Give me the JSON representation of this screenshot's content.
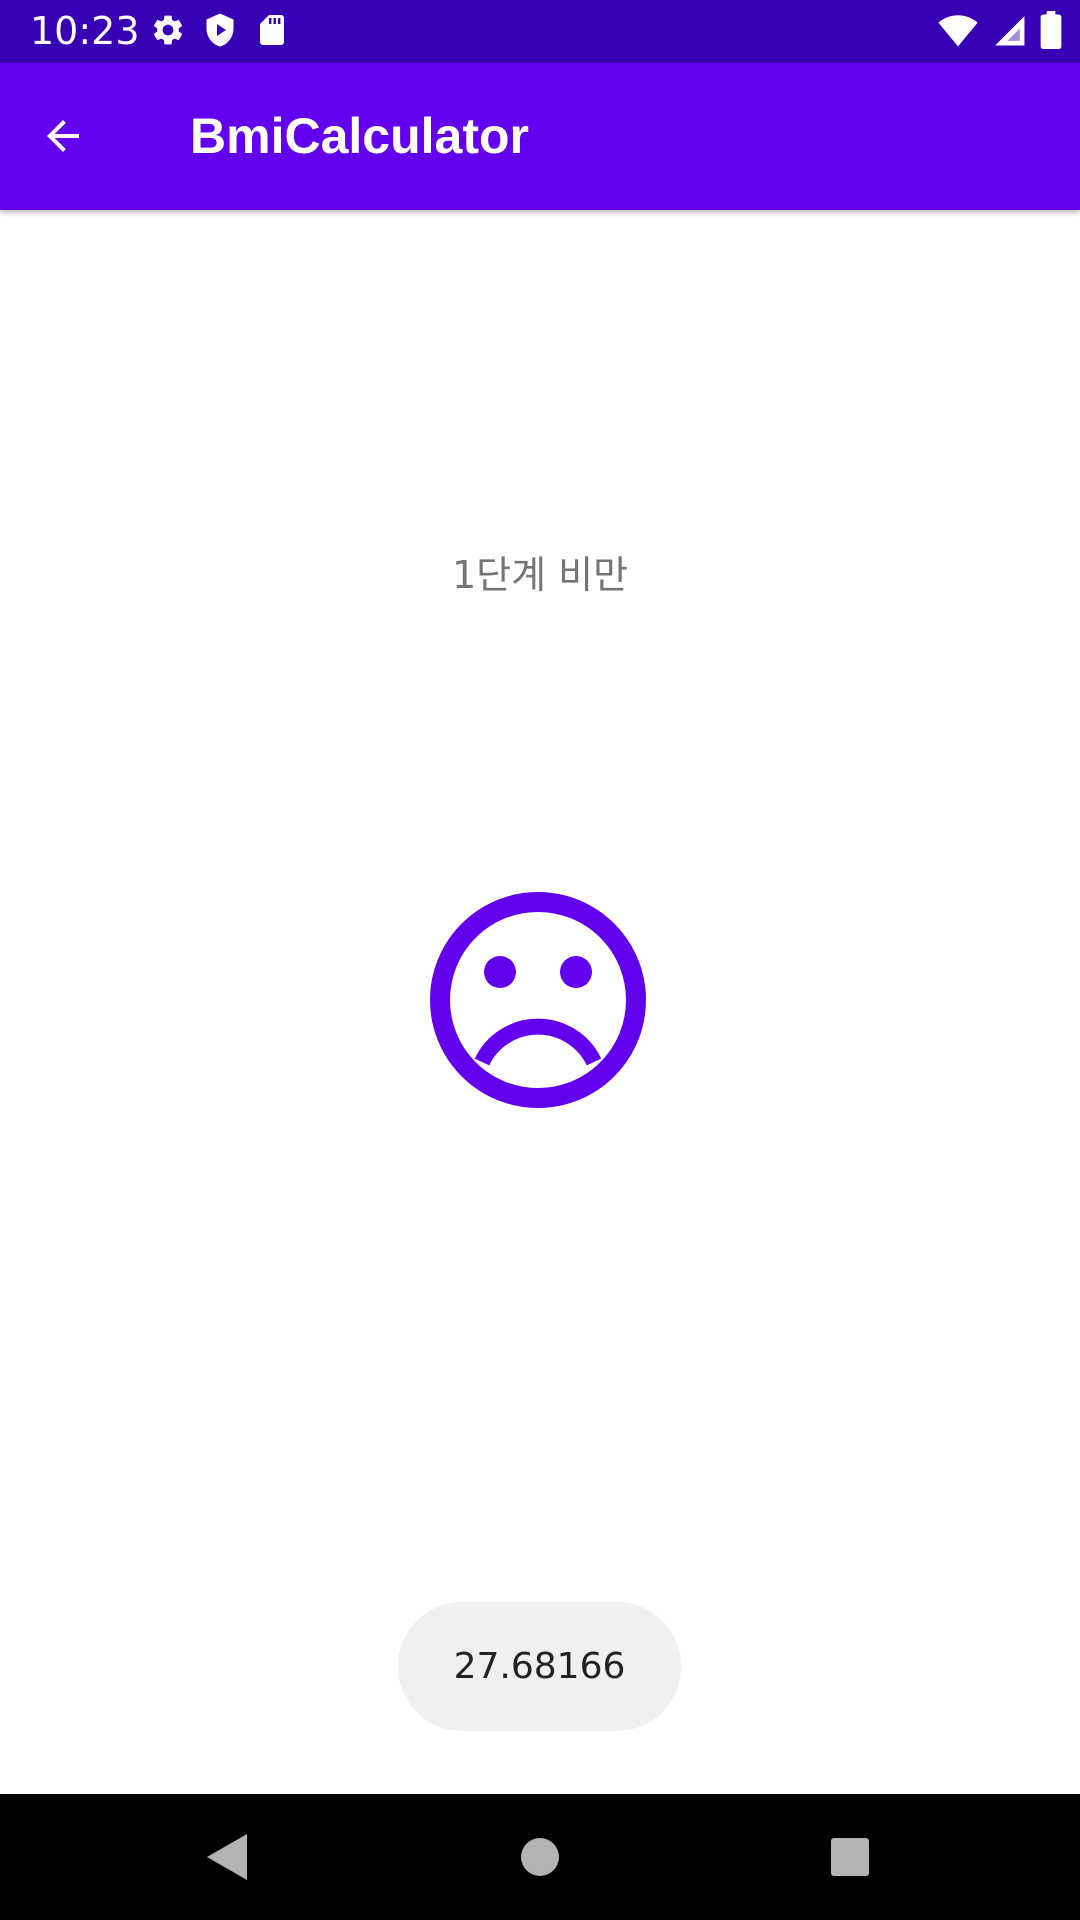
{
  "status_bar": {
    "time": "10:23",
    "left_icons": [
      "settings-icon",
      "shield-play-icon",
      "sd-card-icon"
    ],
    "right_icons": [
      "wifi-icon",
      "cell-signal-icon",
      "battery-icon"
    ]
  },
  "app_bar": {
    "title": "BmiCalculator",
    "back_icon": "arrow-back-icon"
  },
  "result": {
    "label": "1단계 비만",
    "face_icon": "sad-face-icon",
    "bmi_value": "27.68166"
  },
  "nav_bar": {
    "icons": [
      "nav-back-icon",
      "nav-home-icon",
      "nav-recents-icon"
    ]
  },
  "colors": {
    "status_bar": "#3700b3",
    "primary": "#6200ee",
    "result_text": "#757575",
    "chip_background": "#f0f0f0"
  }
}
